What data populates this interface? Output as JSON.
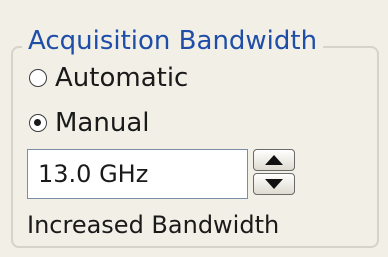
{
  "group": {
    "title": "Acquisition Bandwidth"
  },
  "options": [
    {
      "label": "Automatic",
      "selected": false
    },
    {
      "label": "Manual",
      "selected": true
    }
  ],
  "bandwidth": {
    "value": "13.0 GHz"
  },
  "status": {
    "text": "Increased Bandwidth"
  },
  "colors": {
    "title": "#1f4ea8",
    "background": "#f1efe6",
    "border": "#d6d3c8"
  },
  "icons": {
    "increment": "arrow-up-icon",
    "decrement": "arrow-down-icon"
  }
}
